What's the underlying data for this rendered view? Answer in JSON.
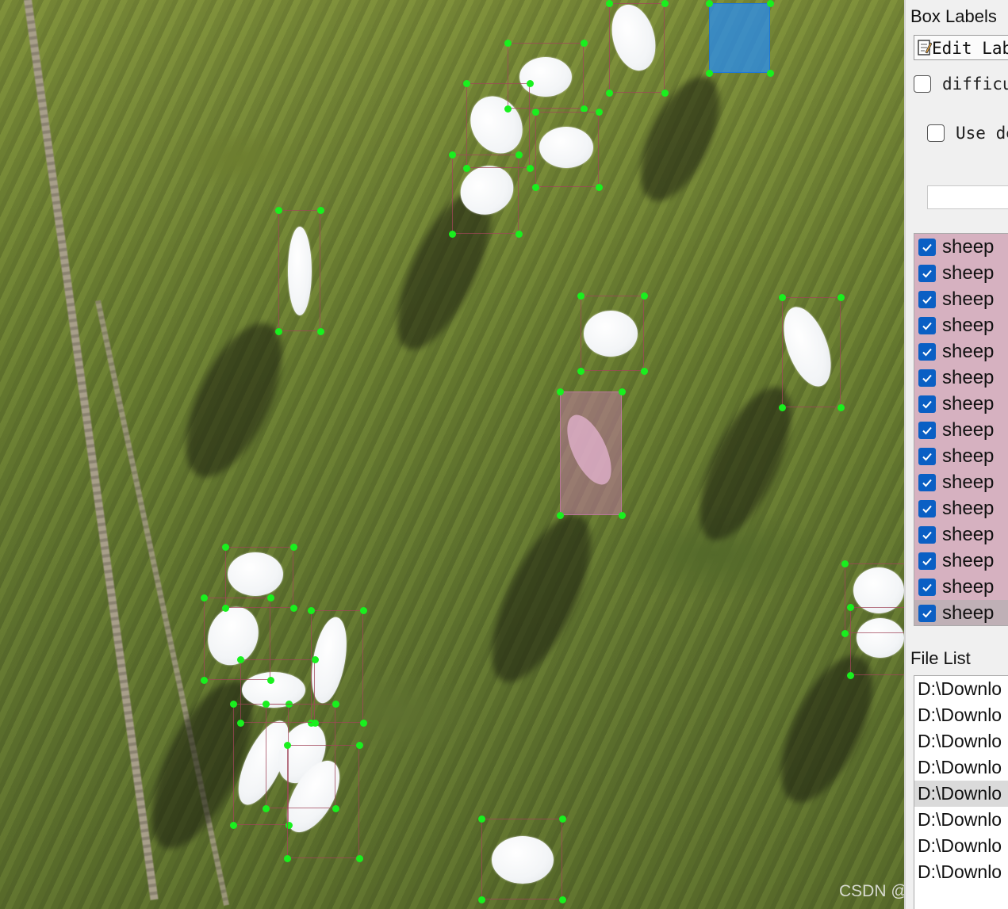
{
  "panel": {
    "box_labels_title": "Box Labels",
    "edit_label_button": "Edit Lab",
    "difficult_label": "difficu",
    "use_default_label": "Use de",
    "file_list_title": "File List"
  },
  "labels": [
    "sheep",
    "sheep",
    "sheep",
    "sheep",
    "sheep",
    "sheep",
    "sheep",
    "sheep",
    "sheep",
    "sheep",
    "sheep",
    "sheep",
    "sheep",
    "sheep",
    "sheep"
  ],
  "files": [
    "D:\\Downlo",
    "D:\\Downlo",
    "D:\\Downlo",
    "D:\\Downlo",
    "D:\\Downlo",
    "D:\\Downlo",
    "D:\\Downlo",
    "D:\\Downlo"
  ],
  "watermark": "CSDN @王哈哈^_^",
  "colors": {
    "grass": "#6a7e32",
    "box_outline": "#a0465a",
    "vertex_point": "#19f01e",
    "selected_box_pink": "#be78a0",
    "selected_box_blue": "#288cf0",
    "checkbox_checked": "#0a5fc4",
    "label_row_bg": "#d6b1c0"
  },
  "icons": {
    "edit_button_icon": "edit-note-icon",
    "check_icon": "checkmark-icon"
  }
}
